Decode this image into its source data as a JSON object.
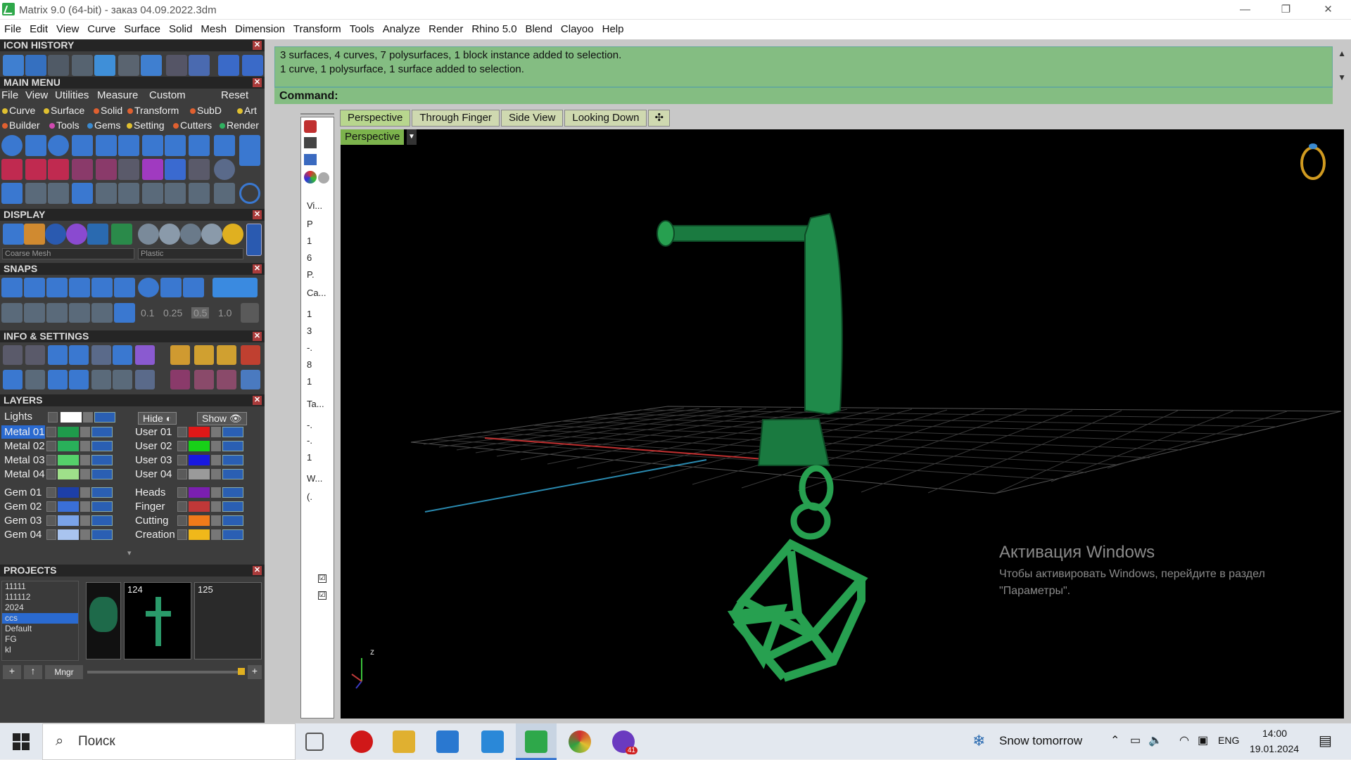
{
  "window": {
    "title": "Matrix 9.0 (64-bit) - заказ 04.09.2022.3dm",
    "minimize": "—",
    "maximize": "❐",
    "close": "✕"
  },
  "menubar": [
    "File",
    "Edit",
    "View",
    "Curve",
    "Surface",
    "Solid",
    "Mesh",
    "Dimension",
    "Transform",
    "Tools",
    "Analyze",
    "Render",
    "Rhino 5.0",
    "Blend",
    "Clayoo",
    "Help"
  ],
  "panels": {
    "icon_history": "ICON HISTORY",
    "main_menu": "MAIN MENU",
    "display": "DISPLAY",
    "snaps": "SNAPS",
    "info_settings": "INFO & SETTINGS",
    "layers": "LAYERS",
    "projects": "PROJECTS"
  },
  "main_menu": {
    "top_items": [
      "File",
      "View",
      "Utilities",
      "Measure",
      "Custom"
    ],
    "reset": "Reset",
    "row1": [
      "Curve",
      "Surface",
      "Solid",
      "Transform",
      "SubD",
      "Art"
    ],
    "row2": [
      "Builder",
      "Tools",
      "Gems",
      "Setting",
      "Cutters",
      "Render"
    ]
  },
  "display": {
    "mesh_select": "Coarse Mesh",
    "material_select": "Plastic"
  },
  "snaps": {
    "values": [
      "0.1",
      "0.25",
      "0.5",
      "1.0"
    ]
  },
  "layers": {
    "lights": "Lights",
    "hide": "Hide",
    "show": "Show",
    "left": [
      {
        "name": "Metal 01",
        "color": "#1f9a4b"
      },
      {
        "name": "Metal 02",
        "color": "#29b05a"
      },
      {
        "name": "Metal 03",
        "color": "#55d06a"
      },
      {
        "name": "Metal 04",
        "color": "#9fe08a"
      },
      {
        "name": "Gem 01",
        "color": "#1d3fa8"
      },
      {
        "name": "Gem 02",
        "color": "#3a6fd8"
      },
      {
        "name": "Gem 03",
        "color": "#7aa3e8"
      },
      {
        "name": "Gem 04",
        "color": "#a9c4ef"
      }
    ],
    "right": [
      {
        "name": "User 01",
        "color": "#e01818"
      },
      {
        "name": "User 02",
        "color": "#18d018"
      },
      {
        "name": "User 03",
        "color": "#1818e0"
      },
      {
        "name": "User 04",
        "color": "#9a9a9a"
      },
      {
        "name": "Heads",
        "color": "#7a1fb0"
      },
      {
        "name": "Finger",
        "color": "#c03838"
      },
      {
        "name": "Cutting",
        "color": "#f07a1a"
      },
      {
        "name": "Creation",
        "color": "#f0b81a"
      }
    ]
  },
  "projects": {
    "list": [
      "11111",
      "111112",
      "2024",
      "ccs",
      "Default",
      "FG",
      "kl"
    ],
    "selected": "ccs",
    "thumb_numbers": [
      "124",
      "125"
    ],
    "mngr": "Mngr"
  },
  "command": {
    "history": [
      "3 surfaces, 4 curves, 7 polysurfaces, 1 block instance added to selection.",
      "1 curve, 1 polysurface, 1 surface added to selection."
    ],
    "label": "Command:"
  },
  "sidebar_chars": [
    "Vi...",
    "P",
    "1",
    "6",
    "P.",
    "Ca...",
    "1",
    "3",
    "-.",
    "8",
    "1",
    "Ta...",
    "-.",
    "-.",
    "1",
    "W...",
    "(."
  ],
  "viewport": {
    "tabs": [
      "Perspective",
      "Through Finger",
      "Side View",
      "Looking Down"
    ],
    "active_tab": "Perspective",
    "label": "Perspective",
    "axis_z": "z",
    "model_color": "#1f9a4b"
  },
  "watermark": {
    "title": "Активация Windows",
    "line1": "Чтобы активировать Windows, перейдите в раздел",
    "line2": "\"Параметры\"."
  },
  "taskbar": {
    "search": "Поиск",
    "weather": "Snow tomorrow",
    "lang": "ENG",
    "time": "14:00",
    "date": "19.01.2024",
    "badge": "41"
  }
}
